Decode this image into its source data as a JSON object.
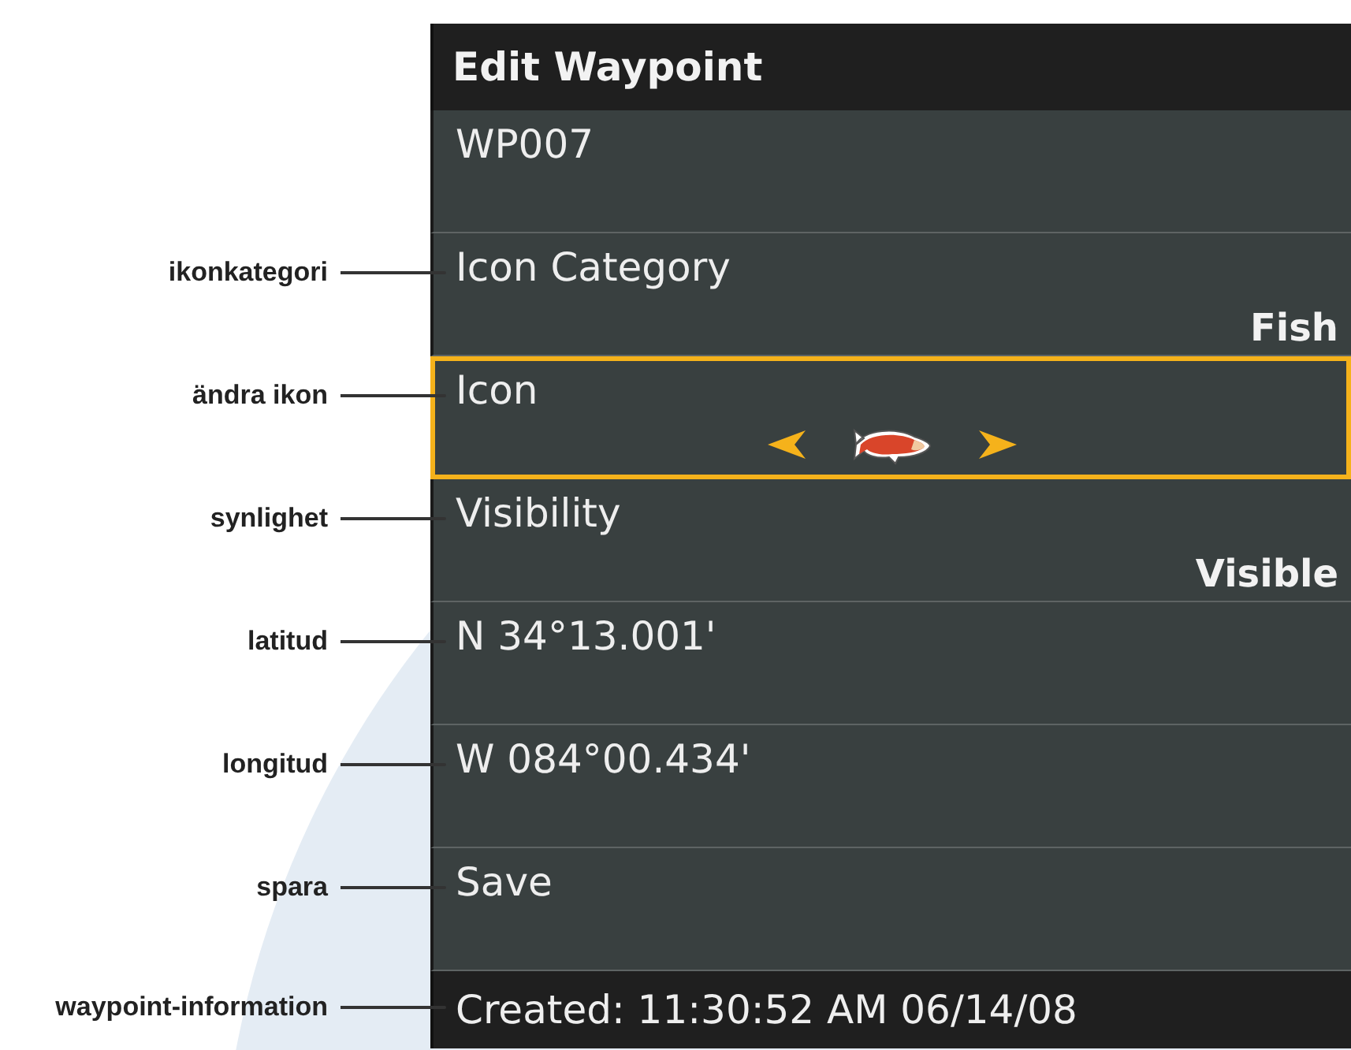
{
  "window": {
    "title": "Edit Waypoint"
  },
  "items": [
    {
      "kind": "text",
      "label": "WP007",
      "selected": false
    },
    {
      "kind": "text",
      "label": "Icon Category",
      "value": "Fish",
      "callout": "ikonkategori",
      "selected": false
    },
    {
      "kind": "icon-picker",
      "label": "Icon",
      "callout": "ändra ikon",
      "selected": true
    },
    {
      "kind": "text",
      "label": "Visibility",
      "value": "Visible",
      "callout": "synlighet",
      "selected": false
    },
    {
      "kind": "text",
      "label": "N 34°13.001'",
      "callout": "latitud",
      "selected": false
    },
    {
      "kind": "text",
      "label": "W 084°00.434'",
      "callout": "longitud",
      "selected": false
    },
    {
      "kind": "text",
      "label": "Save",
      "callout": "spara",
      "selected": false
    }
  ],
  "status_bar": {
    "text": "Created: 11:30:52 AM 06/14/08",
    "callout": "waypoint-information"
  }
}
